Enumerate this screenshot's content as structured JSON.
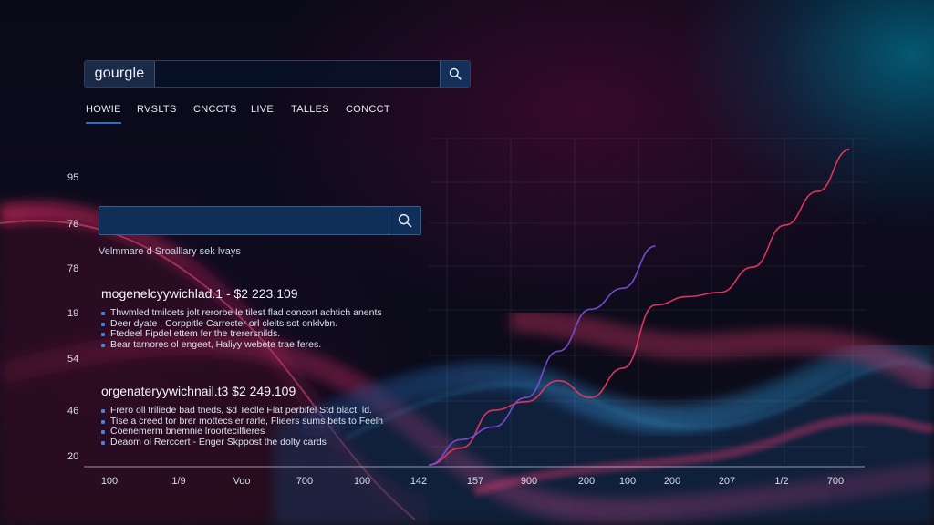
{
  "header": {
    "logo_text": "gourgle",
    "search_value": "",
    "search_icon": "search-icon"
  },
  "nav": {
    "items": [
      {
        "label": "HOWIE",
        "active": true
      },
      {
        "label": "RVSLTS",
        "active": false
      },
      {
        "label": "CNCCTS",
        "active": false
      },
      {
        "label": "LIVE",
        "active": false
      },
      {
        "label": "TALLES",
        "active": false
      },
      {
        "label": "CONCCT",
        "active": false
      }
    ]
  },
  "search": {
    "value": "",
    "icon": "search-icon",
    "meta_text": "Velmmare d Sroalllary sek lvays"
  },
  "results": [
    {
      "title": "mogenelcyywichlad.1 - $2 223.109",
      "bullets": [
        "Thwmled tmilcets jolt rerorbe le tilest flad concort achtich anents",
        "Deer dyate . Corppitle Carrecter orl cleits sot onklvbn.",
        "Ftedeel Fipdel ettem fer the trerersnilds.",
        "Bear tarnores ol engeet, Haliyy webete trae feres."
      ]
    },
    {
      "title": "orgenateryywichnail.t3 $2 249.109",
      "bullets": [
        "Frero oll triliede bad tneds, $d Teclle Flat perbifel Std blact, ld.",
        "Tise a creed tor brer mottecs er rarle, Flieers sums bets to Feelh",
        "Coenemerm bnemnie lroortecilfieres",
        "Deaom ol Rerccert - Enger Skppost the dolty cards"
      ]
    }
  ],
  "chart_data": {
    "type": "line",
    "y_tick_labels": [
      "95",
      "78",
      "78",
      "19",
      "54",
      "46",
      "20"
    ],
    "x_tick_labels": [
      "100",
      "1/9",
      "Voo",
      "700",
      "100",
      "142",
      "157",
      "900",
      "200",
      "100",
      "200",
      "207",
      "1/2",
      "700"
    ],
    "series": [
      {
        "color": "#e8375f",
        "values": [
          20,
          24,
          33,
          35,
          40,
          36,
          43,
          58,
          60,
          61,
          67,
          77,
          85,
          95
        ]
      },
      {
        "color": "#7a4ed8",
        "values": [
          20,
          26,
          29,
          36,
          47,
          57,
          62,
          72
        ]
      }
    ],
    "grid": true
  },
  "colors": {
    "accent": "#2f6fc0",
    "line_red": "#e8375f",
    "line_purple": "#7a4ed8",
    "bg_teal": "#0096b9"
  }
}
